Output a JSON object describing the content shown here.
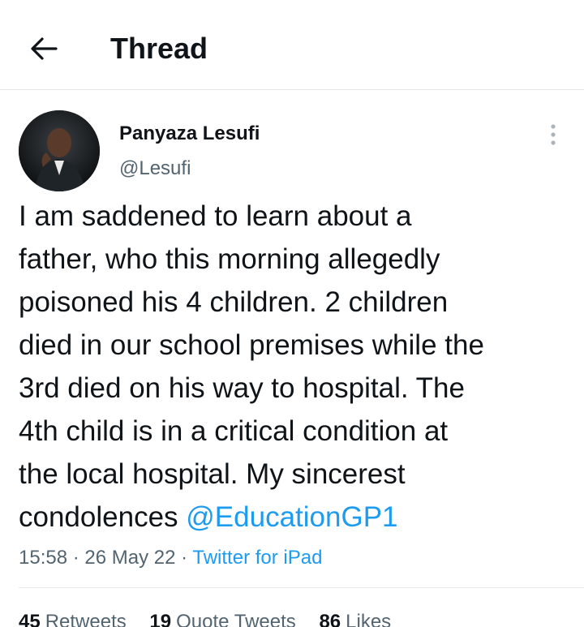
{
  "header": {
    "back_icon": "arrow-left-icon",
    "title": "Thread"
  },
  "tweet": {
    "author": {
      "name": "Panyaza Lesufi",
      "handle": "@Lesufi",
      "avatar_icon": "avatar-photo"
    },
    "more_icon": "more-vertical-icon",
    "text": "I am saddened to learn about a\nfather, who this morning allegedly\npoisoned his 4 children. 2 children\ndied in our school premises while the\n3rd died on his way to hospital. The\n4th child is in a critical condition at\nthe local hospital. My sincerest\ncondolences ",
    "mention": "@EducationGP1",
    "time": "15:58",
    "date": "26 May 22",
    "separator": "·",
    "source": "Twitter for iPad"
  },
  "stats": {
    "retweets": {
      "count": "45",
      "label": "Retweets"
    },
    "quote_tweets": {
      "count": "19",
      "label": "Quote Tweets"
    },
    "likes": {
      "count": "86",
      "label": "Likes"
    }
  },
  "colors": {
    "accent": "#1d9bf0",
    "text": "#0f1419",
    "secondary": "#536471",
    "border": "#e6e9eb"
  }
}
